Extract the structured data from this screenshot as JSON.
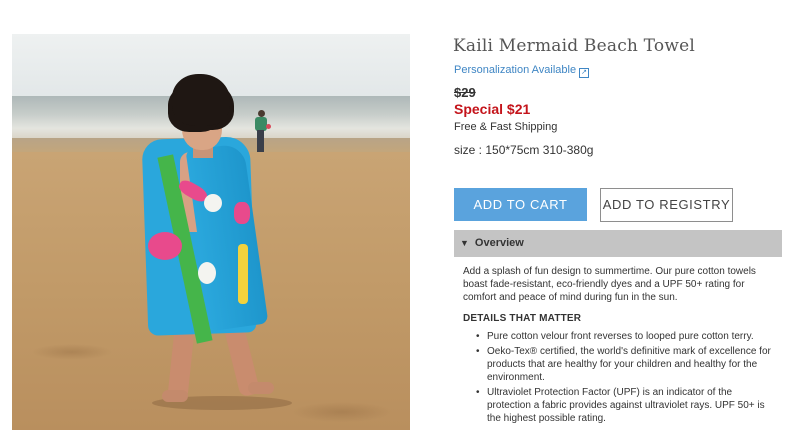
{
  "product": {
    "title": "Kaili Mermaid Beach Towel",
    "personalization_label": "Personalization Available",
    "personalization_icon": "external-link-icon",
    "old_price": "$29",
    "special_price": "Special $21",
    "shipping": "Free & Fast Shipping",
    "size": "size : 150*75cm 310-380g"
  },
  "actions": {
    "add_to_cart": "ADD TO CART",
    "add_to_registry": "ADD TO REGISTRY"
  },
  "overview": {
    "toggle_icon": "triangle-down-icon",
    "label": "Overview",
    "description": "Add a splash of fun design to summertime. Our pure cotton towels boast fade-resistant, eco-friendly dyes and a UPF 50+ rating for comfort and peace of mind during fun in the sun.",
    "details_heading": "DETAILS THAT MATTER",
    "details": [
      "Pure cotton velour front reverses to looped pure cotton terry.",
      "Oeko-Tex® certified, the world's definitive mark of excellence for products that are healthy for your children and healthy for the environment.",
      "Ultraviolet Protection Factor (UPF) is an indicator of the protection a fabric provides against ultraviolet rays. UPF 50+ is the highest possible rating."
    ]
  },
  "colors": {
    "cart_button": "#5aa3dd",
    "special_price": "#c4141b",
    "link": "#3f86c4",
    "overview_bar": "#c4c4c4"
  }
}
